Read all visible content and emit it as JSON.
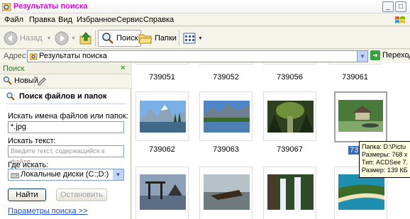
{
  "window": {
    "title": "Результаты поиска"
  },
  "menu": [
    "Файл",
    "Правка",
    "Вид",
    "Избранное",
    "Сервис",
    "Справка"
  ],
  "toolbar": {
    "back_label": "Назад",
    "search_label": "Поиск",
    "folders_label": "Папки"
  },
  "address": {
    "label": "Адрес:",
    "value": "Результаты поиска",
    "go_label": "Переход"
  },
  "search_pane": {
    "title": "Поиск",
    "new_label": "Новый",
    "heading": "Поиск файлов и папок",
    "filename_label": "Искать имена файлов или папок:",
    "filename_value": "*.jpg",
    "text_label": "Искать текст:",
    "text_placeholder": "Введите текст, содержащийся в файле.",
    "where_label": "Где искать:",
    "where_value": "Локальные диски (C:;D:)",
    "find_label": "Найти",
    "stop_label": "Остановить",
    "options_link": "Параметры поиска >>"
  },
  "files": {
    "row1": [
      "739051",
      "739052",
      "739056",
      "739061"
    ],
    "row2": [
      "739062",
      "739063",
      "739067",
      "739069"
    ],
    "row3": [
      "",
      "",
      "",
      ""
    ],
    "selected": "739069"
  },
  "tooltip": {
    "folder": "Папка: D:\\Pictu",
    "size_dim": "Размеры: 768 x",
    "type": "Тип: ACDSee 7.",
    "size": "Размер: 139 КБ"
  },
  "colors": {
    "title": "#e000e0",
    "pane_title": "#2f7b2f",
    "link": "#1c4fd3",
    "selection": "#316ac5"
  }
}
